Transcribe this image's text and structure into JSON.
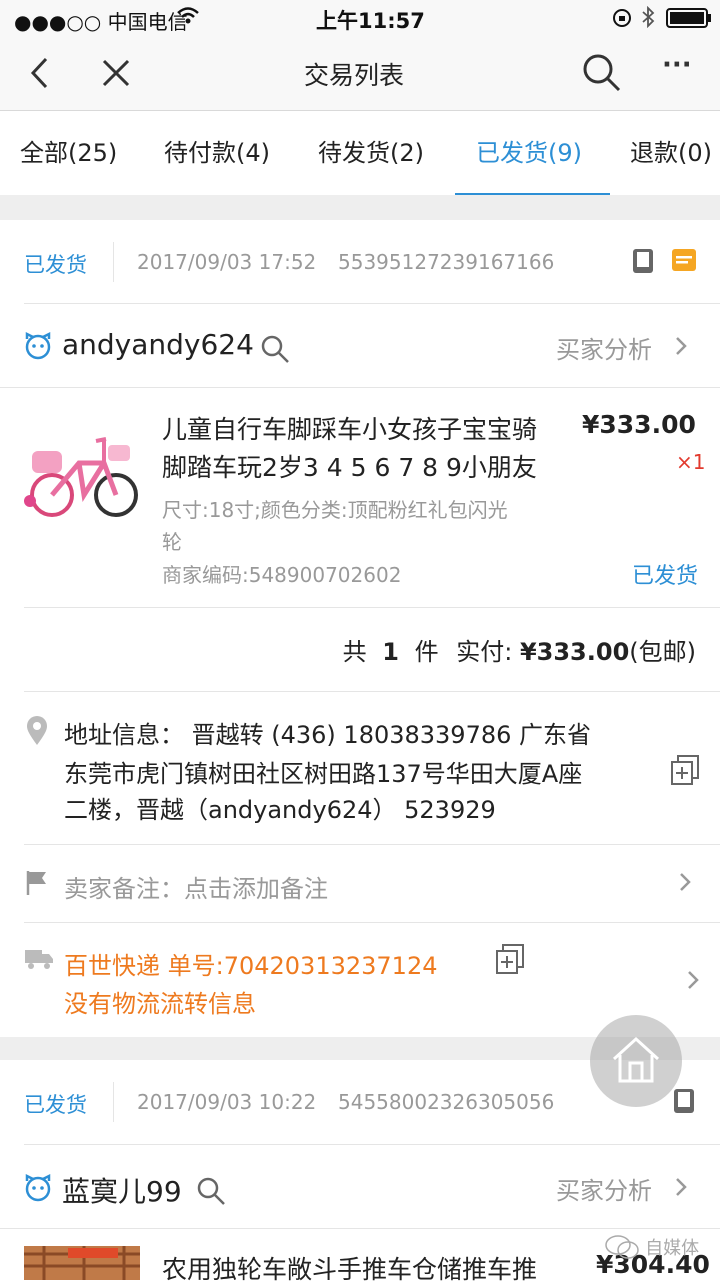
{
  "status_bar": {
    "carrier": "●●●○○ 中国电信",
    "time": "上午11:57"
  },
  "nav": {
    "title": "交易列表",
    "more": "···"
  },
  "tabs": [
    {
      "label": "全部(25)",
      "active": false
    },
    {
      "label": "待付款(4)",
      "active": false
    },
    {
      "label": "待发货(2)",
      "active": false
    },
    {
      "label": "已发货(9)",
      "active": true
    },
    {
      "label": "退款(0)",
      "active": false
    }
  ],
  "orders": [
    {
      "status": "已发货",
      "datetime": "2017/09/03 17:52",
      "order_no": "55395127239167166",
      "buyer": "andyandy624",
      "buyer_analysis": "买家分析",
      "product": {
        "title_line1": "儿童自行车脚踩车小女孩子宝宝骑",
        "title_line2": "脚踏车玩2岁3 4 5 6 7 8 9小朋友",
        "price": "¥333.00",
        "qty": "×1",
        "spec_line1": "尺寸:18寸;颜色分类:顶配粉红礼包闪光",
        "spec_line2": "轮",
        "merchant_code": "商家编码:548900702602",
        "item_status": "已发货"
      },
      "summary": {
        "total_prefix": "共",
        "count": "1",
        "count_unit": "件",
        "paid_label": "实付:",
        "paid_amount": "¥333.00",
        "shipping_note": "(包邮)"
      },
      "address": {
        "line1": "地址信息： 晋越转 (436) 18038339786  广东省",
        "line2": "东莞市虎门镇树田社区树田路137号华田大厦A座",
        "line3": "二楼，晋越（andyandy624） 523929"
      },
      "seller_note": "卖家备注：点击添加备注",
      "logistics": {
        "line1": "百世快递 单号:70420313237124",
        "line2": "没有物流流转信息"
      }
    },
    {
      "status": "已发货",
      "datetime": "2017/09/03 10:22",
      "order_no": "54558002326305056",
      "buyer": "蓝寞儿99",
      "buyer_analysis": "买家分析",
      "product": {
        "title_line1": "农用独轮车敞斗手推车仓储推车推",
        "price": "¥304.40"
      }
    }
  ],
  "watermark": "自媒体",
  "colors": {
    "accent": "#2d8fd5",
    "orange": "#ee7a1f",
    "qty_red": "#e23a2e"
  }
}
